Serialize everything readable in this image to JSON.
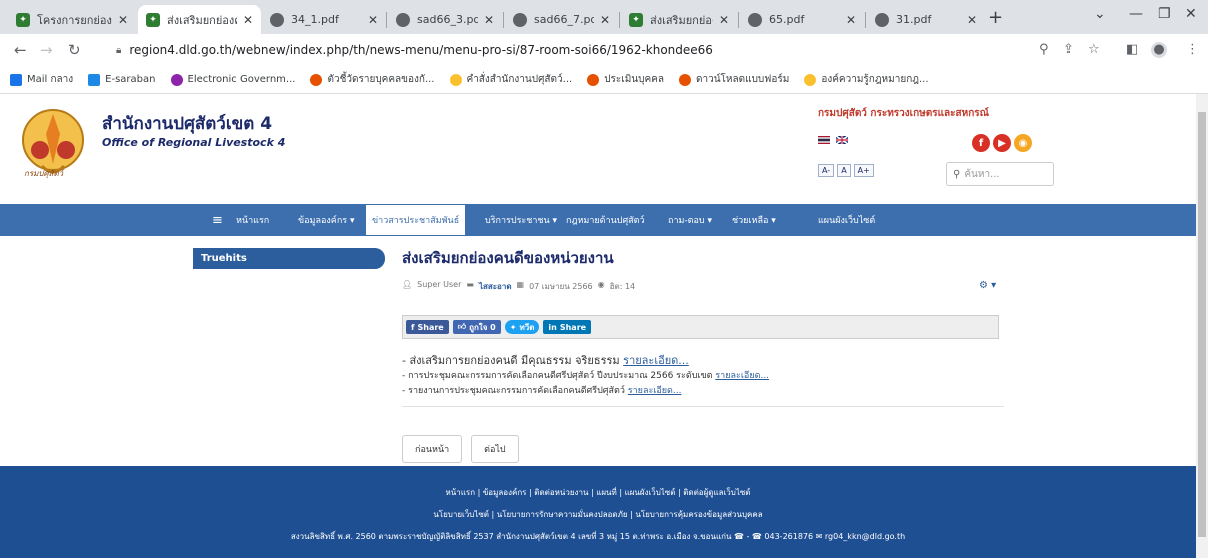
{
  "browser": {
    "tabs": [
      {
        "title": "โครงการยกย่อง",
        "icon_color": "#2e7d32"
      },
      {
        "title": "ส่งเสริมยกย่องค",
        "icon_color": "#2e7d32"
      },
      {
        "title": "34_1.pdf",
        "icon_color": "#5f6368"
      },
      {
        "title": "sad66_3.pdf",
        "icon_color": "#5f6368"
      },
      {
        "title": "sad66_7.pdf",
        "icon_color": "#5f6368"
      },
      {
        "title": "ส่งเสริมยกย่องค",
        "icon_color": "#2e7d32"
      },
      {
        "title": "65.pdf",
        "icon_color": "#5f6368"
      },
      {
        "title": "31.pdf",
        "icon_color": "#5f6368"
      }
    ],
    "url": "region4.dld.go.th/webnew/index.php/th/news-menu/menu-pro-si/87-room-soi66/1962-khondee66"
  },
  "bookmarks": [
    {
      "label": "Mail กลาง",
      "color": "#1a73e8"
    },
    {
      "label": "E-saraban",
      "color": "#1e88e5"
    },
    {
      "label": "Electronic Governm...",
      "color": "#8e24aa"
    },
    {
      "label": "ตัวชี้วัดรายบุคคลของกั...",
      "color": "#e65100"
    },
    {
      "label": "คำสั่งสำนักงานปศุสัตว์...",
      "color": "#fbc02d"
    },
    {
      "label": "ประเมินบุคคล",
      "color": "#e65100"
    },
    {
      "label": "ดาวน์โหลดแบบฟอร์ม",
      "color": "#e65100"
    },
    {
      "label": "องค์ความรู้กฎหมายกฎ...",
      "color": "#fbc02d"
    }
  ],
  "site": {
    "name_th": "สำนักงานปศุสัตว์เขต 4",
    "name_en": "Office of Regional Livestock 4",
    "emblem_caption": "กรมปศุสัตว์",
    "dept": "กรมปศุสัตว์ กระทรวงเกษตรและสหกรณ์",
    "font_sizes": [
      "A-",
      "A",
      "A+"
    ],
    "search_placeholder": "ค้นหา..."
  },
  "nav": [
    "หน้าแรก",
    "ข้อมูลองค์กร ▾",
    "ข่าวสารประชาสัมพันธ์",
    "บริการประชาชน ▾",
    "กฎหมายด้านปศุสัตว์",
    "ถาม-ตอบ ▾",
    "ช่วยเหลือ ▾",
    "แผนผังเว็บไซต์"
  ],
  "sidebar": {
    "truehits": "Truehits"
  },
  "article": {
    "title": "ส่งเสริมยกย่องคนดีของหน่วยงาน",
    "author": "Super User",
    "category": "ไสสะอาด",
    "date": "07 เมษายน 2566",
    "hits": "ฮิต: 14",
    "share": [
      "Share",
      "ถูกใจ 0",
      "ทวีต",
      "Share"
    ],
    "lines": [
      {
        "text": "- ส่งเสริมการยกย่องคนดี มีคุณธรรม จริยธรรม ",
        "link": "รายละเอียด..."
      },
      {
        "text": "- การประชุมคณะกรรมการคัดเลือกคนดีศรีปศุสัตว์ ปีงบประมาณ 2566 ระดับเขต ",
        "link": "รายละเอียด..."
      },
      {
        "text": "- รายงานการประชุมคณะกรรมการคัดเลือกคนดีศรีปศุสัตว์ ",
        "link": "รายละเอียด..."
      }
    ],
    "prev": "ก่อนหน้า",
    "next": "ต่อไป"
  },
  "footer": {
    "row1": "หน้าแรก | ข้อมูลองค์กร | ติดต่อหน่วยงาน | แผนที่ | แผนผังเว็บไซต์ | ติดต่อผู้ดูแลเว็บไซต์",
    "row2": "นโยบายเว็บไซต์ | นโยบายการรักษาความมั่นคงปลอดภัย | นโยบายการคุ้มครองข้อมูลส่วนบุคคล",
    "row3": "สงวนลิขสิทธิ์ พ.ศ. 2560 ตามพระราชบัญญัติลิขสิทธิ์ 2537 สำนักงานปศุสัตว์เขต 4 เลขที่ 3 หมู่ 15 ต.ท่าพระ อ.เมือง จ.ขอนแก่น ☎ - ☎ 043-261876 ✉ rg04_kkn@dld.go.th"
  }
}
